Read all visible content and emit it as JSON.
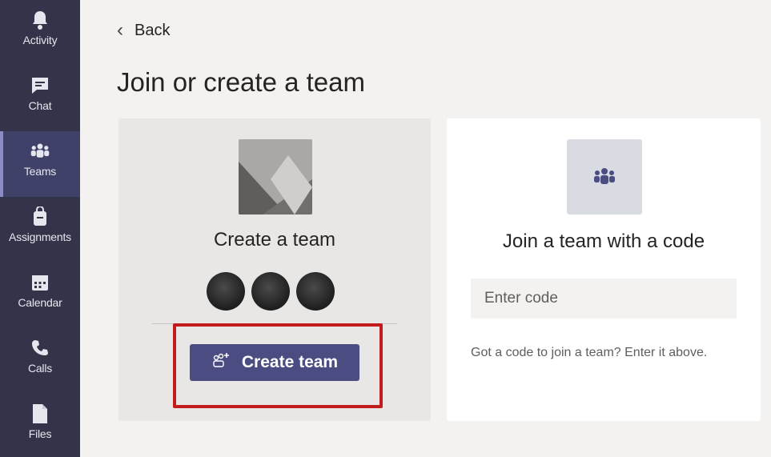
{
  "sidebar": {
    "items": [
      {
        "label": "Activity",
        "icon": "bell-icon"
      },
      {
        "label": "Chat",
        "icon": "chat-icon"
      },
      {
        "label": "Teams",
        "icon": "teams-icon",
        "active": true
      },
      {
        "label": "Assignments",
        "icon": "assignments-icon"
      },
      {
        "label": "Calendar",
        "icon": "calendar-icon"
      },
      {
        "label": "Calls",
        "icon": "phone-icon"
      },
      {
        "label": "Files",
        "icon": "file-icon"
      }
    ]
  },
  "header": {
    "back_label": "Back",
    "title": "Join or create a team"
  },
  "create_card": {
    "title": "Create a team",
    "button_label": "Create team"
  },
  "join_card": {
    "title": "Join a team with a code",
    "input_placeholder": "Enter code",
    "hint": "Got a code to join a team? Enter it above."
  },
  "colors": {
    "rail_bg": "#33344a",
    "accent": "#4b4c82",
    "highlight": "#c21c1c"
  }
}
